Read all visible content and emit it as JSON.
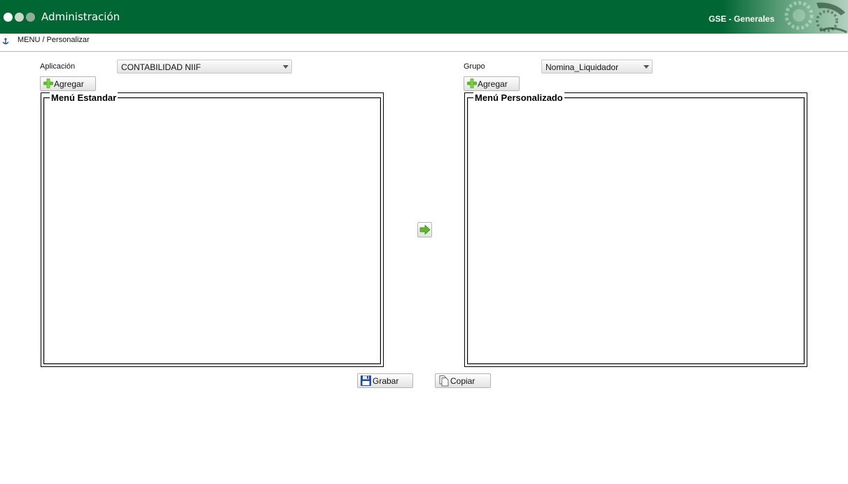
{
  "header": {
    "app_title": "Administración",
    "company": "GSE - Generales"
  },
  "breadcrumb": "MENU / Personalizar",
  "form": {
    "aplicacion_label": "Aplicación",
    "aplicacion_value": "CONTABILIDAD NIIF",
    "grupo_label": "Grupo",
    "grupo_value": "Nomina_Liquidador",
    "agregar_left_label": "Agregar",
    "agregar_right_label": "Agregar"
  },
  "panels": {
    "standard_title": "Menú Estandar",
    "custom_title": "Menú Personalizado"
  },
  "actions": {
    "grabar_label": "Grabar",
    "copiar_label": "Copiar"
  },
  "colors": {
    "header_bg": "#006633",
    "accent_green": "#5fb82e"
  },
  "icons": {
    "move": "arrow-right-icon",
    "add": "plus-icon",
    "save": "floppy-disk-icon",
    "copy": "document-copy-icon"
  }
}
